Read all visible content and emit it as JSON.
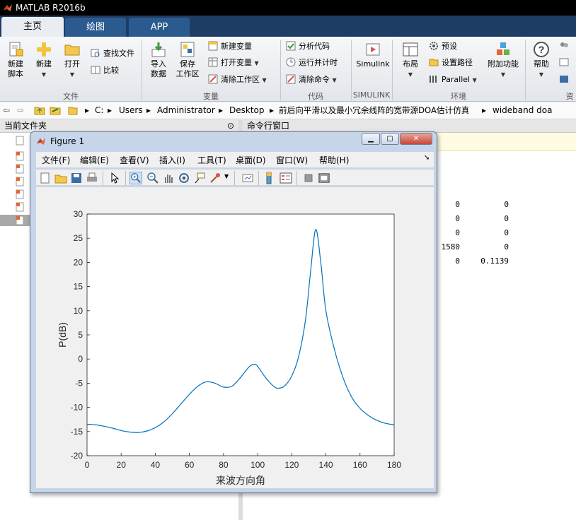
{
  "app": {
    "title": "MATLAB R2016b"
  },
  "tabs": [
    {
      "label": "主页",
      "active": true
    },
    {
      "label": "绘图",
      "active": false
    },
    {
      "label": "APP",
      "active": false
    }
  ],
  "ribbon": {
    "file": {
      "new_script": "新建\n脚本",
      "new": "新建",
      "open": "打开",
      "find_files": "查找文件",
      "compare": "比较",
      "group": "文件"
    },
    "variable": {
      "import": "导入\n数据",
      "save_workspace": "保存\n工作区",
      "new_variable": "新建变量",
      "open_variable": "打开变量",
      "clear_workspace": "清除工作区",
      "group": "变量"
    },
    "code": {
      "analyze": "分析代码",
      "run_time": "运行并计时",
      "clear_commands": "清除命令",
      "group": "代码"
    },
    "simulink": {
      "label": "Simulink",
      "group": "SIMULINK"
    },
    "environment": {
      "layout": "布局",
      "preferences": "预设",
      "set_path": "设置路径",
      "parallel": "Parallel",
      "addons": "附加功能",
      "group": "环境"
    },
    "resources": {
      "help": "帮助",
      "group": "资"
    }
  },
  "path": [
    "C:",
    "Users",
    "Administrator",
    "Desktop",
    "前后向平滑以及最小冗余线阵的宽带源DOA估计仿真",
    "wideband doa"
  ],
  "panels": {
    "current_folder": "当前文件夹",
    "command_window": "命令行窗口"
  },
  "matrix_rows": [
    [
      "0",
      "0"
    ],
    [
      "0",
      "0"
    ],
    [
      "0",
      "0"
    ],
    [
      "1580",
      "0"
    ],
    [
      "0",
      "0.1139"
    ]
  ],
  "figure": {
    "title": "Figure 1",
    "menu": [
      "文件(F)",
      "编辑(E)",
      "查看(V)",
      "插入(I)",
      "工具(T)",
      "桌面(D)",
      "窗口(W)",
      "帮助(H)"
    ],
    "toolbar_icons": [
      "new-figure-icon",
      "open-file-icon",
      "save-icon",
      "print-icon",
      "pointer-icon",
      "zoom-in-icon",
      "zoom-out-icon",
      "pan-hand-icon",
      "rotate-3d-icon",
      "data-cursor-icon",
      "brush-icon",
      "link-plot-icon",
      "colorbar-icon",
      "legend-icon",
      "hide-plot-tools-icon",
      "show-plot-tools-icon"
    ]
  },
  "colors": {
    "line": "#0072bd",
    "tabbar": "#1e3d64",
    "tab": "#2b5a8f"
  },
  "chart_data": {
    "type": "line",
    "title": "",
    "xlabel": "来波方向角",
    "ylabel": "P(dB)",
    "xlim": [
      0,
      180
    ],
    "ylim": [
      -20,
      30
    ],
    "xticks": [
      0,
      20,
      40,
      60,
      80,
      100,
      120,
      140,
      160,
      180
    ],
    "yticks": [
      -20,
      -15,
      -10,
      -5,
      0,
      5,
      10,
      15,
      20,
      25,
      30
    ],
    "grid": true,
    "series": [
      {
        "x": [
          0,
          5,
          10,
          15,
          20,
          25,
          30,
          35,
          40,
          45,
          50,
          55,
          60,
          65,
          70,
          75,
          80,
          85,
          90,
          95,
          98,
          100,
          105,
          110,
          113,
          116,
          120,
          124,
          128,
          131,
          134,
          137,
          140,
          145,
          150,
          155,
          160,
          165,
          170,
          175,
          180
        ],
        "y": [
          -13.5,
          -13.6,
          -13.9,
          -14.3,
          -14.8,
          -15.1,
          -15.2,
          -14.9,
          -14.2,
          -13.0,
          -11.3,
          -9.3,
          -7.3,
          -5.6,
          -4.7,
          -5.0,
          -5.8,
          -5.6,
          -3.8,
          -1.6,
          -1.1,
          -1.5,
          -4.0,
          -5.8,
          -6.0,
          -5.5,
          -3.5,
          0.5,
          8.0,
          18.0,
          26.8,
          20.0,
          10.0,
          2.0,
          -3.8,
          -7.8,
          -10.2,
          -11.7,
          -12.7,
          -13.3,
          -13.6
        ]
      }
    ]
  }
}
